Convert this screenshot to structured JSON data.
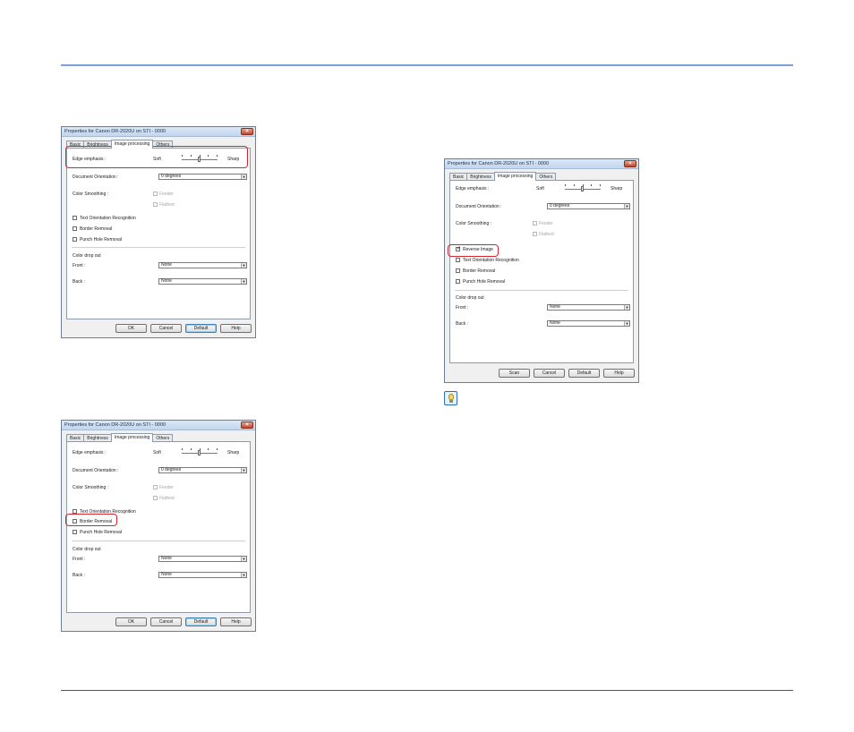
{
  "dialogs": [
    {
      "title": "Properties for Canon DR-2020U on STI - 0000",
      "tabs": [
        "Basic",
        "Brightness",
        "Image processing",
        "Others"
      ],
      "edge_label": "Edge emphasis :",
      "soft": "Soft",
      "sharp": "Sharp",
      "orientation_label": "Document Orientation :",
      "orientation_value": "0 degrees",
      "smoothing_label": "Color Smoothing :",
      "feeder": "Feeder",
      "flatbed": "Flatbed",
      "text_orient": "Text Orientation Recognition",
      "border": "Border Removal",
      "punch": "Punch Hole Removal",
      "dropout_label": "Color drop out",
      "front_label": "Front :",
      "front_value": "None",
      "back_label": "Back :",
      "back_value": "None",
      "buttons": [
        "OK",
        "Cancel",
        "Default",
        "Help"
      ]
    },
    {
      "title": "Properties for Canon DR-2020U on STI - 0000",
      "tabs": [
        "Basic",
        "Brightness",
        "Image processing",
        "Others"
      ],
      "edge_label": "Edge emphasis :",
      "soft": "Soft",
      "sharp": "Sharp",
      "orientation_label": "Document Orientation :",
      "orientation_value": "0 degrees",
      "smoothing_label": "Color Smoothing :",
      "feeder": "Feeder",
      "flatbed": "Flatbed",
      "text_orient": "Text Orientation Recognition",
      "border": "Border Removal",
      "punch": "Punch Hole Removal",
      "dropout_label": "Color drop out",
      "front_label": "Front :",
      "front_value": "None",
      "back_label": "Back :",
      "back_value": "None",
      "buttons": [
        "OK",
        "Cancel",
        "Default",
        "Help"
      ]
    },
    {
      "title": "Properties for Canon DR-2020U on STI - 0000",
      "tabs": [
        "Basic",
        "Brightness",
        "Image processing",
        "Others"
      ],
      "edge_label": "Edge emphasis :",
      "soft": "Soft",
      "sharp": "Sharp",
      "orientation_label": "Document Orientation :",
      "orientation_value": "0 degrees",
      "smoothing_label": "Color Smoothing :",
      "feeder": "Feeder",
      "flatbed": "Flatbed",
      "reverse": "Reverse Image",
      "text_orient": "Text Orientation Recognition",
      "border": "Border Removal",
      "punch": "Punch Hole Removal",
      "dropout_label": "Color drop out",
      "front_label": "Front :",
      "front_value": "None",
      "back_label": "Back :",
      "back_value": "None",
      "buttons": [
        "Scan",
        "Cancel",
        "Default",
        "Help"
      ]
    }
  ],
  "colors": {
    "highlight": "#d7262e",
    "rule": "#5b7fc4"
  },
  "icons": {
    "hint": "lightbulb-hint-icon"
  }
}
